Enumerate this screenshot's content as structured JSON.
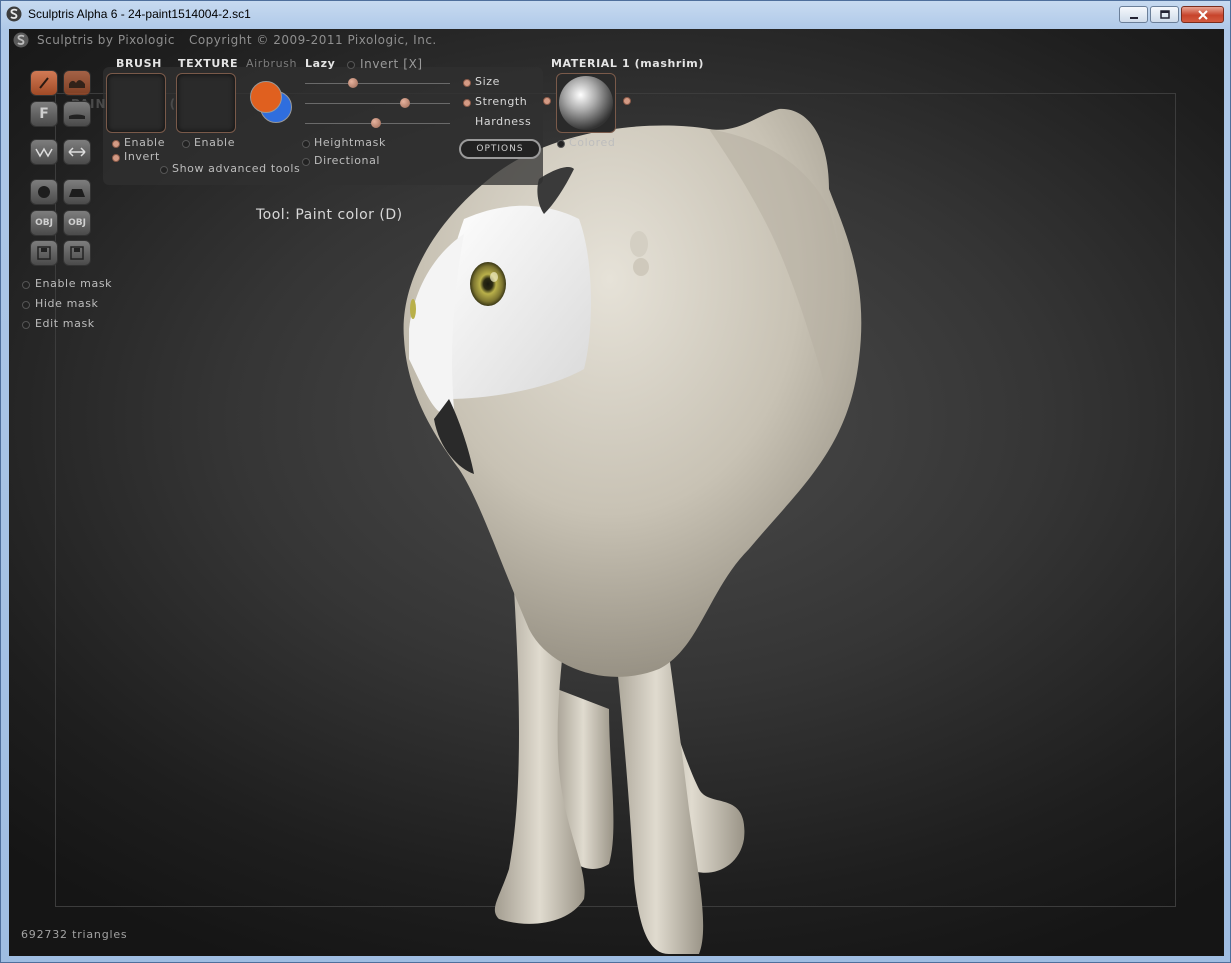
{
  "window": {
    "title": "Sculptris Alpha 6 - 24-paint1514004-2.sc1"
  },
  "header": {
    "product": "Sculptris by Pixologic",
    "copyright": "Copyright © 2009-2011 Pixologic, Inc."
  },
  "toolbar": {
    "brush_label": "BRUSH",
    "texture_label": "TEXTURE",
    "airbrush_label": "Airbrush",
    "lazy_label": "Lazy",
    "invert_label": "Invert [X]",
    "size_label": "Size",
    "strength_label": "Strength",
    "hardness_label": "Hardness",
    "options_label": "OPTIONS",
    "brush_enable": "Enable",
    "brush_invert": "Invert",
    "texture_enable": "Enable",
    "show_advanced": "Show advanced tools",
    "heightmask": "Heightmask",
    "directional": "Directional",
    "ghost_label": "PAINT BUMP (S)",
    "sliders": {
      "size": 0.33,
      "strength": 0.69,
      "hardness": 0.49
    },
    "primary_color": "#e0601f",
    "secondary_color": "#2f6ede"
  },
  "material": {
    "label": "MATERIAL 1 (mashrim)",
    "colored_label": "Colored"
  },
  "tools": {
    "letter_f": "F",
    "obj_label": "OBJ"
  },
  "mask": {
    "enable": "Enable mask",
    "hide": "Hide mask",
    "edit": "Edit mask"
  },
  "status": {
    "tool": "Tool: Paint color (D)",
    "triangles": "692732 triangles"
  },
  "colors": {
    "accent": "#d49b85",
    "model": "#ddd8cc"
  }
}
